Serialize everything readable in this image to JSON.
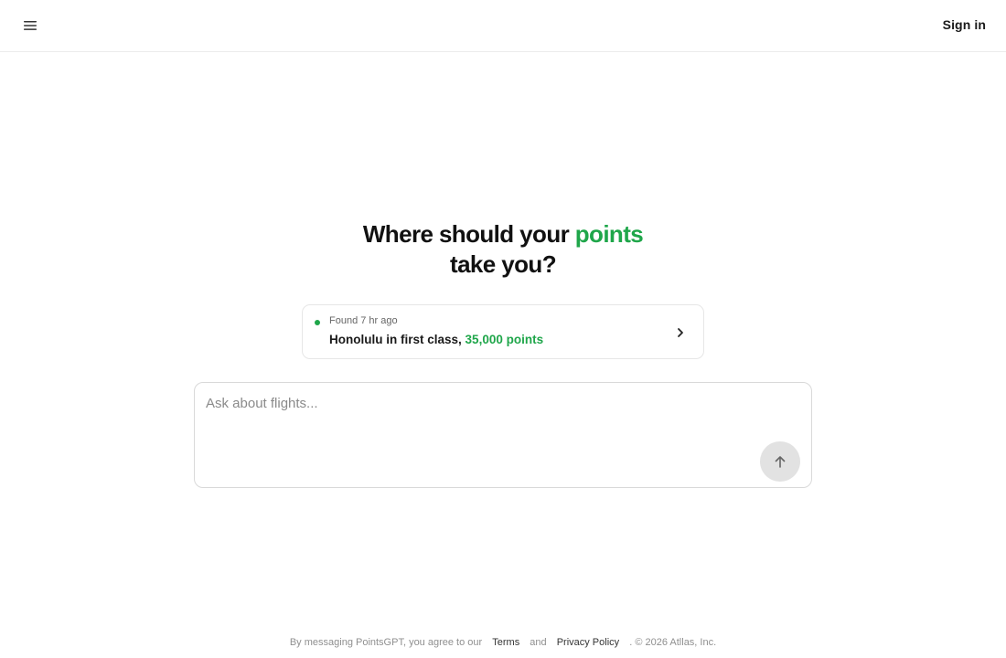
{
  "header": {
    "menu_icon": "hamburger-menu-icon",
    "signin_label": "Sign in"
  },
  "hero": {
    "title_part1": "Where should your",
    "title_accent": "points",
    "title_part2": "take you?",
    "accent_color": "#1fa64a"
  },
  "deal_card": {
    "status": "Found 7 hr ago",
    "title": "Honolulu in first class,",
    "points": "35,000 points",
    "chevron_icon": "chevron-right-icon"
  },
  "composer": {
    "placeholder": "Ask about flights...",
    "send_icon": "arrow-up-icon"
  },
  "footer": {
    "prefix": "By messaging PointsGPT, you agree to our",
    "terms_label": "Terms",
    "and_text": "and",
    "privacy_label": "Privacy Policy",
    "suffix": ". © 2026 Atllas, Inc."
  }
}
